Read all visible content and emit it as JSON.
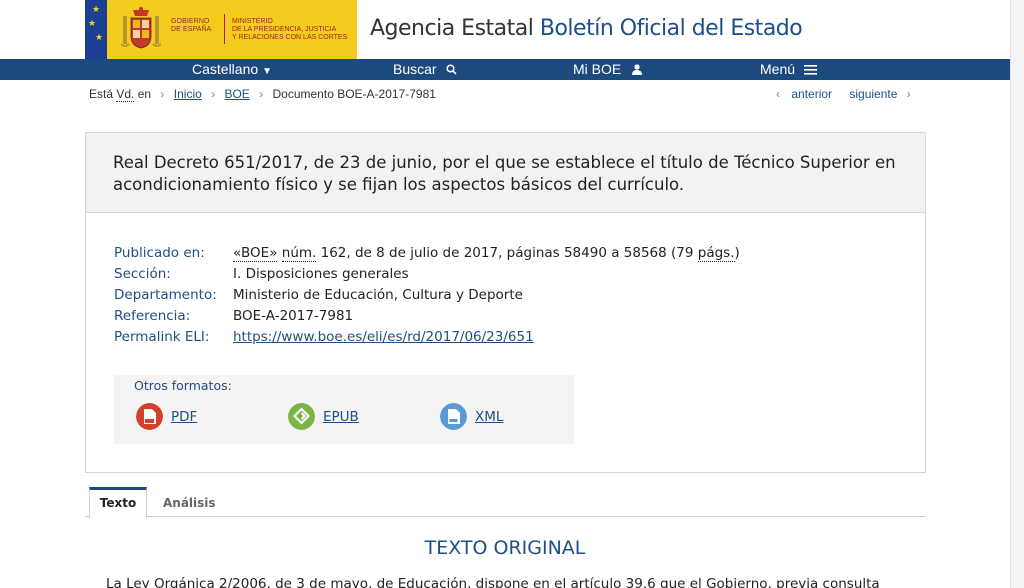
{
  "header": {
    "gov_line1": "GOBIERNO",
    "gov_line2": "DE ESPAÑA",
    "min_line1": "MINISTERIO",
    "min_line2": "DE LA PRESIDENCIA, JUSTICIA",
    "min_line3": "Y RELACIONES CON LAS CORTES",
    "agency_prefix": "Agencia Estatal",
    "agency_name": "Boletín Oficial del Estado"
  },
  "nav": {
    "language": "Castellano",
    "search": "Buscar",
    "my_boe": "Mi BOE",
    "menu": "Menú"
  },
  "breadcrumb": {
    "prefix_a": "Está",
    "prefix_abbr": "Vd.",
    "prefix_b": "en",
    "home": "Inicio",
    "boe": "BOE",
    "current": "Documento BOE-A-2017-7981",
    "prev": "anterior",
    "next": "siguiente"
  },
  "document": {
    "title": "Real Decreto 651/2017, de 23 de junio, por el que se establece el título de Técnico Superior en acondicionamiento físico y se fijan los aspectos básicos del currículo.",
    "labels": {
      "published": "Publicado en:",
      "section": "Sección:",
      "department": "Departamento:",
      "reference": "Referencia:",
      "permalink": "Permalink ELI:"
    },
    "published": {
      "boe": "«BOE»",
      "num_abbr": "núm.",
      "rest": "162, de 8 de julio de 2017, páginas 58490 a 58568 (79",
      "pags_abbr": "págs.",
      "close": ")"
    },
    "section": "I. Disposiciones generales",
    "department": "Ministerio de Educación, Cultura y Deporte",
    "reference": "BOE-A-2017-7981",
    "permalink": "https://www.boe.es/eli/es/rd/2017/06/23/651"
  },
  "formats": {
    "label": "Otros formatos:",
    "pdf": "PDF",
    "epub": "EPUB",
    "xml": "XML"
  },
  "tabs": {
    "text": "Texto",
    "analysis": "Análisis"
  },
  "content": {
    "heading": "TEXTO ORIGINAL",
    "first_line": "La Ley Orgánica 2/2006, de 3 de mayo, de Educación, dispone en el artículo 39.6 que el Gobierno, previa consulta"
  },
  "colors": {
    "navy": "#1d4a7c",
    "link_blue": "#1d4f86",
    "gov_yellow": "#f4cc1d",
    "gov_red": "#a3221b",
    "pdf_red": "#d2402b",
    "epub_green": "#7cb342",
    "xml_blue": "#5b9bd5"
  }
}
